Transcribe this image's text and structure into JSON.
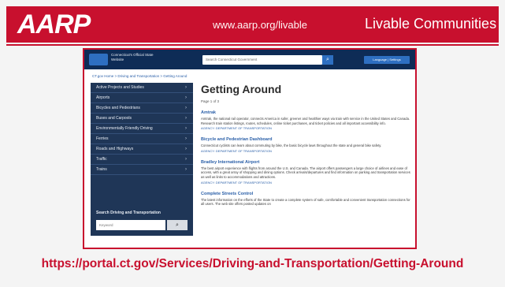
{
  "header": {
    "logo": "AARP",
    "url": "www.aarp.org/livable",
    "title": "Livable Communities"
  },
  "portal": {
    "logo_text": "Connecticut's Official State Website",
    "search_placeholder": "Search Connecticut Government",
    "language_label": "Language | Settings",
    "breadcrumb": "CT.gov Home > Driving and Transportation > Getting Around",
    "sidebar": {
      "items": [
        {
          "label": "Active Projects and Studies"
        },
        {
          "label": "Airports"
        },
        {
          "label": "Bicycles and Pedestrians"
        },
        {
          "label": "Buses and Carpools"
        },
        {
          "label": "Environmentally Friendly Driving"
        },
        {
          "label": "Ferries"
        },
        {
          "label": "Roads and Highways"
        },
        {
          "label": "Traffic"
        },
        {
          "label": "Trains"
        }
      ],
      "search_label": "Search Driving and Transportation",
      "search_placeholder": "Keyword"
    },
    "main": {
      "title": "Getting Around",
      "page_count": "Page 1 of 3",
      "entries": [
        {
          "title": "Amtrak",
          "desc": "Amtrak, the national rail operator, connects America in safer, greener and healthier ways via train with service in the United States and Canada. Research train station listings, routes, schedules, online ticket purchases, and ticket policies and all important accessibility info.",
          "link": "AGENCY: DEPARTMENT OF TRANSPORTATION"
        },
        {
          "title": "Bicycle and Pedestrian Dashboard",
          "desc": "Connecticut cyclists can learn about commuting by bike, the basic bicycle laws throughout the state and general bike safety.",
          "link": "AGENCY: DEPARTMENT OF TRANSPORTATION"
        },
        {
          "title": "Bradley International Airport",
          "desc": "The best airport experience with flights from around the U.S. and Canada. The airport offers passengers a large choice of airlines and ease of access, with a great array of shopping and dining options. Check arrivals/departures and find information on parking and transportation services as well as links to accommodations and attractions.",
          "link": "AGENCY: DEPARTMENT OF TRANSPORTATION"
        },
        {
          "title": "Complete Streets Control",
          "desc": "The latest information on the efforts of the State to create a complete system of safe, comfortable and convenient transportation connections for all users. The web site offers posted updates on",
          "link": ""
        }
      ]
    }
  },
  "bottom_url": "https://portal.ct.gov/Services/Driving-and-Transportation/Getting-Around"
}
